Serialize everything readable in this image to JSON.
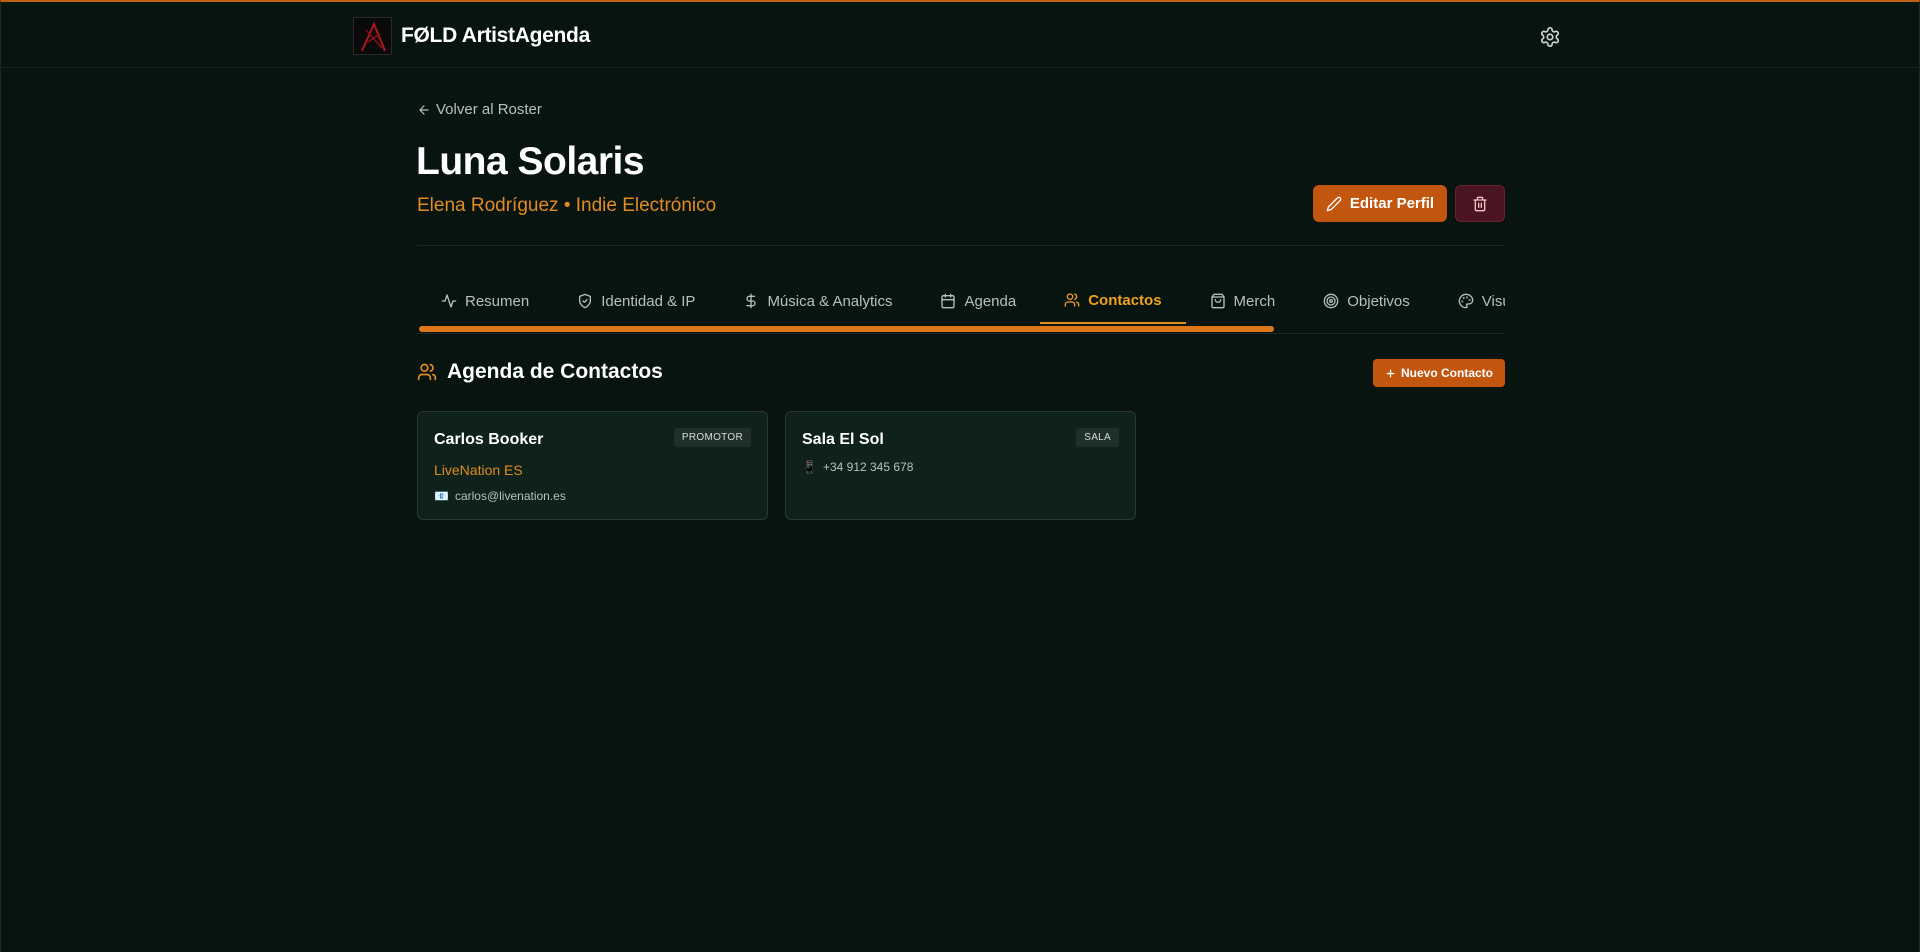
{
  "app": {
    "brand": "FØLD ArtistAgenda"
  },
  "header": {
    "back_label": "Volver al Roster",
    "artist_name": "Luna Solaris",
    "subtitle": "Elena Rodríguez • Indie Electrónico",
    "edit_label": "Editar Perfil"
  },
  "tabs": [
    {
      "label": "Resumen",
      "icon": "activity-icon"
    },
    {
      "label": "Identidad & IP",
      "icon": "shield-icon"
    },
    {
      "label": "Música & Analytics",
      "icon": "dollar-icon"
    },
    {
      "label": "Agenda",
      "icon": "calendar-icon"
    },
    {
      "label": "Contactos",
      "icon": "users-icon",
      "active": true
    },
    {
      "label": "Merch",
      "icon": "shopping-bag-icon"
    },
    {
      "label": "Objetivos",
      "icon": "target-icon"
    },
    {
      "label": "Visu",
      "icon": "palette-icon"
    }
  ],
  "section": {
    "title": "Agenda de Contactos",
    "new_contact_label": "Nuevo Contacto"
  },
  "contacts": [
    {
      "name": "Carlos Booker",
      "role": "PROMOTOR",
      "company": "LiveNation ES",
      "email_icon": "📧",
      "email": "carlos@livenation.es"
    },
    {
      "name": "Sala El Sol",
      "role": "SALA",
      "phone_icon": "📱",
      "phone": "+34 912 345 678"
    }
  ],
  "colors": {
    "accent": "#e38b1f",
    "button": "#c2560f",
    "background": "#071410",
    "card": "#0f211b",
    "danger": "#4a1420"
  }
}
